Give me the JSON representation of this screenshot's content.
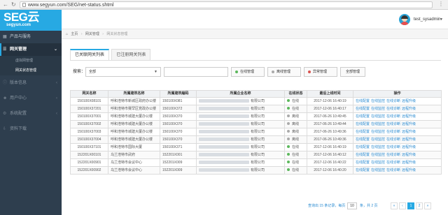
{
  "browser": {
    "url": "www.segyun.com/SEG/net-status.shtml"
  },
  "brand": {
    "logo": "SEG云",
    "sub": "segyun.com"
  },
  "sidebar": {
    "items": [
      {
        "label": "产品与服务",
        "icon": "grid-icon"
      },
      {
        "label": "网关管理",
        "icon": "gateway-icon"
      },
      {
        "label": "版本信息",
        "icon": "info-icon"
      },
      {
        "label": "用户中心",
        "icon": "user-icon"
      },
      {
        "label": "系统配置",
        "icon": "gear-icon"
      },
      {
        "label": "资料下载",
        "icon": "download-icon"
      }
    ],
    "subitems": [
      {
        "label": "虚拟网管理"
      },
      {
        "label": "网关状态管理"
      }
    ]
  },
  "header": {
    "username": "test_sysadmin"
  },
  "breadcrumb": {
    "home": "主页",
    "level1": "网关管理",
    "current": "网关状态管理"
  },
  "tabs": [
    {
      "label": "已关联网关列表"
    },
    {
      "label": "已注册网关列表"
    }
  ],
  "toolbar": {
    "search_label": "搜索：",
    "select_value": "全部",
    "search_value": "",
    "buttons": [
      {
        "label": "在线管理",
        "color": "#5cb85c"
      },
      {
        "label": "离线管理",
        "color": "#aaaaaa"
      },
      {
        "label": "异常管理",
        "color": "#d9534f"
      },
      {
        "label": "全部管理",
        "color": ""
      }
    ]
  },
  "table": {
    "headers": [
      "网关名称",
      "所属建筑名称",
      "所属建筑编码",
      "所属企业名称",
      "在线状态",
      "最后上线时间",
      "操作"
    ],
    "company_suffix": "有限公司",
    "ops": [
      "在线配置",
      "在线监控",
      "在线诊断",
      "远程升级"
    ],
    "rows": [
      {
        "name": "150100X08101",
        "building": "呼和浩特市新城区政府办公楼",
        "code": "150100X081",
        "status": "在线",
        "status_color": "#5cb85c",
        "time": "2017-12-06 16:40:19"
      },
      {
        "name": "150100X37201",
        "building": "呼和浩特市赛罕区党政办公楼",
        "code": "150100X372",
        "status": "在线",
        "status_color": "#5cb85c",
        "time": "2017-12-06 16:40:17"
      },
      {
        "name": "150100X37001",
        "building": "呼和浩特市城建大厦办公楼",
        "code": "150100X370",
        "status": "离线",
        "status_color": "#aaaaaa",
        "time": "2017-06-26 10:49:45"
      },
      {
        "name": "150100X37002",
        "building": "呼和浩特市城建大厦办公楼",
        "code": "150100X370",
        "status": "离线",
        "status_color": "#aaaaaa",
        "time": "2017-06-26 10:49:44"
      },
      {
        "name": "150100X37003",
        "building": "呼和浩特市城建大厦办公楼",
        "code": "150100X370",
        "status": "离线",
        "status_color": "#aaaaaa",
        "time": "2017-06-26 10:49:36"
      },
      {
        "name": "150100X37004",
        "building": "呼和浩特市城建大厦办公楼",
        "code": "150100X370",
        "status": "离线",
        "status_color": "#aaaaaa",
        "time": "2017-06-26 10:49:36"
      },
      {
        "name": "150100X37101",
        "building": "呼和浩特市国际大厦",
        "code": "150100X371",
        "status": "在线",
        "status_color": "#5cb85c",
        "time": "2017-12-06 16:40:19"
      },
      {
        "name": "152201X00101",
        "building": "乌兰浩特市武府",
        "code": "152201X001",
        "status": "在线",
        "status_color": "#5cb85c",
        "time": "2017-12-06 16:40:12"
      },
      {
        "name": "152201X00901",
        "building": "乌兰浩特市会议中心",
        "code": "152201X009",
        "status": "在线",
        "status_color": "#5cb85c",
        "time": "2017-12-06 16:40:22"
      },
      {
        "name": "152201X00902",
        "building": "乌兰浩特市会议中心",
        "code": "152201X009",
        "status": "在线",
        "status_color": "#5cb85c",
        "time": "2017-12-06 16:40:20"
      }
    ]
  },
  "pagination": {
    "info_prefix": "查询出 15 条记录，每页",
    "page_size": "10",
    "info_suffix": "条，共 2 页",
    "first": "«",
    "prev": "‹",
    "pages": [
      "1",
      "2"
    ],
    "next": "»"
  }
}
